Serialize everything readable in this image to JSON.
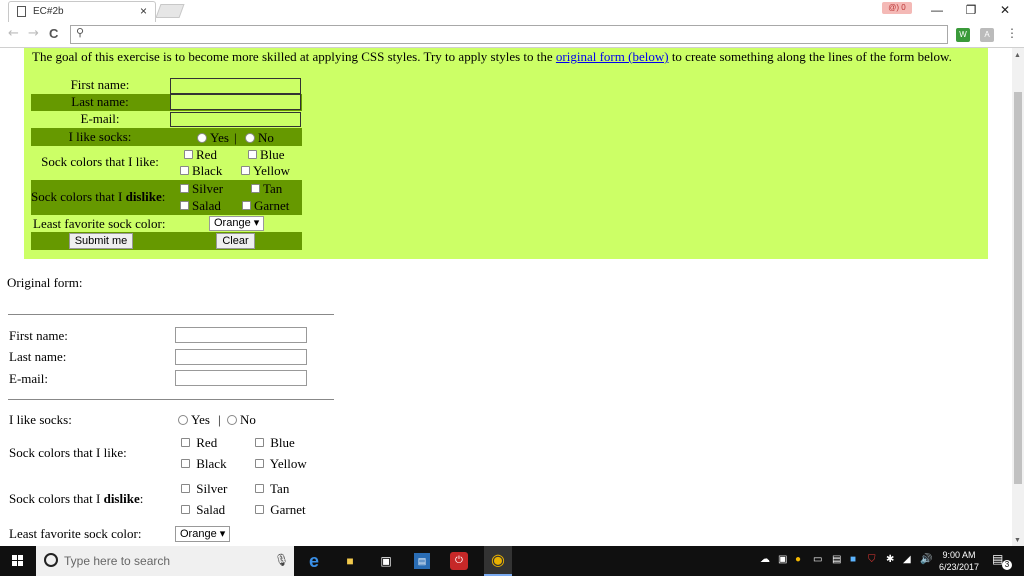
{
  "browser": {
    "tab_title": "EC#2b",
    "tab_close": "×",
    "profile_badge": "@) 0",
    "minimize": "—",
    "restore": "❐",
    "close": "✕",
    "back": "←",
    "forward": "→",
    "reload": "C",
    "address_value": "",
    "ext1": "W",
    "ext2": "A",
    "menu": "⋮"
  },
  "styled_form": {
    "intro_before": "The goal of this exercise is to become more skilled at applying CSS styles. Try to apply styles to the ",
    "intro_link": "original form (below)",
    "intro_after": " to create something along the lines of the form below.",
    "first_name_label": "First name:",
    "last_name_label": "Last name:",
    "email_label": "E-mail:",
    "socks_label": "I like socks:",
    "yes": "Yes",
    "sep": "|",
    "no": "No",
    "like_label": "Sock colors that I like:",
    "red": "Red",
    "blue": "Blue",
    "black": "Black",
    "yellow": "Yellow",
    "dislike_label_pre": "Sock colors that I ",
    "dislike_label_bold": "dislike",
    "dislike_label_post": ":",
    "silver": "Silver",
    "tan": "Tan",
    "salad": "Salad",
    "garnet": "Garnet",
    "least_label": "Least favorite sock color:",
    "least_value": "Orange ▾",
    "submit": "Submit me",
    "clear": "Clear"
  },
  "original_form": {
    "heading": "Original form:",
    "first_name_label": "First name:",
    "last_name_label": "Last name:",
    "email_label": "E-mail:",
    "socks_label": "I like socks:",
    "yes": "Yes",
    "sep": "|",
    "no": "No",
    "like_label": "Sock colors that I like:",
    "red": "Red",
    "blue": "Blue",
    "black": "Black",
    "yellow": "Yellow",
    "dislike_label_pre": "Sock colors that I ",
    "dislike_label_bold": "dislike",
    "dislike_label_post": ":",
    "silver": "Silver",
    "tan": "Tan",
    "salad": "Salad",
    "garnet": "Garnet",
    "least_label": "Least favorite sock color:",
    "least_value": "Orange ▾"
  },
  "taskbar": {
    "search_placeholder": "Type here to search",
    "time": "9:00 AM",
    "date": "6/23/2017",
    "notif_count": "3"
  },
  "colors": {
    "form_bg": "#ccff66",
    "row_dark": "#669900"
  }
}
